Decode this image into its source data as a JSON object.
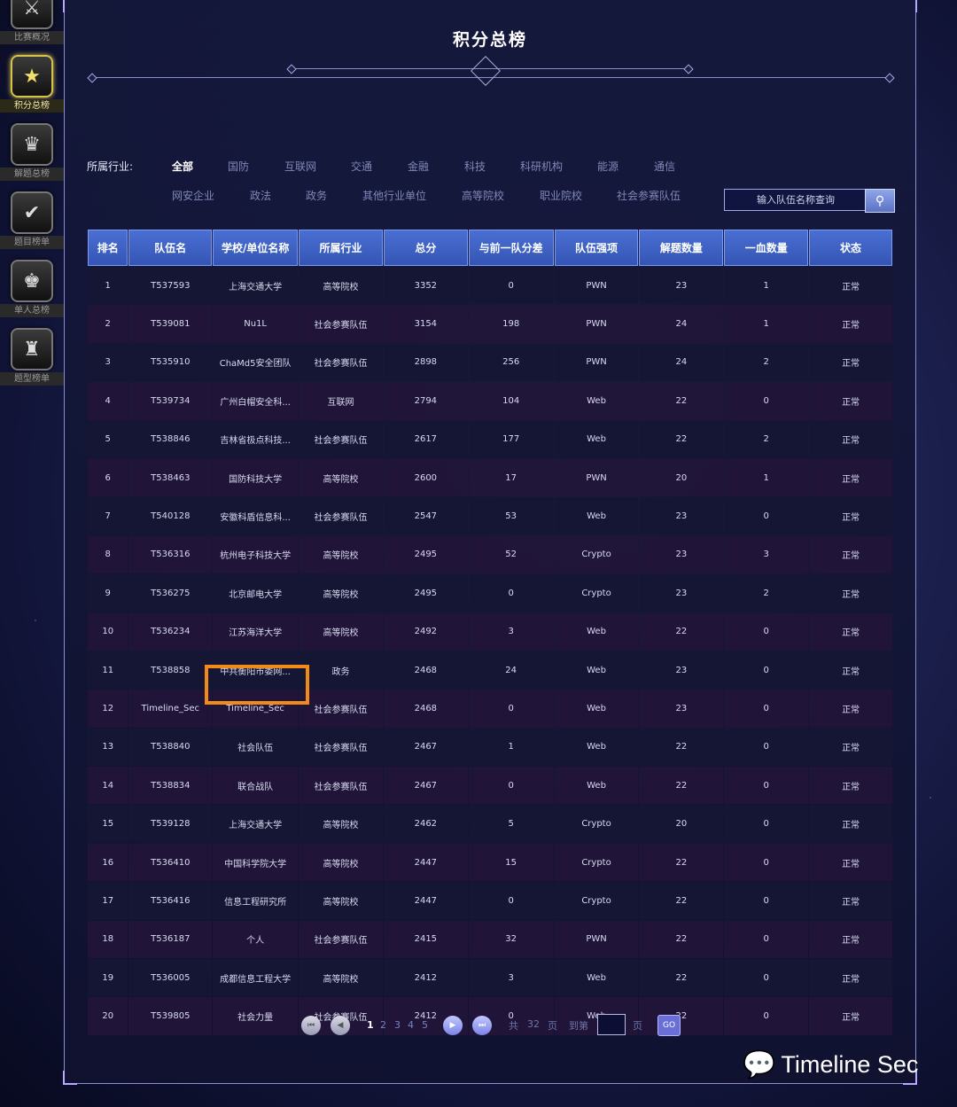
{
  "sidebar": [
    {
      "label": "比赛概况",
      "icon": "crossed-swords-icon",
      "glyph": "⚔",
      "active": false
    },
    {
      "label": "积分总榜",
      "icon": "star-badge-icon",
      "glyph": "★",
      "active": true
    },
    {
      "label": "解题总榜",
      "icon": "trophy-icon",
      "glyph": "♛",
      "active": false
    },
    {
      "label": "题目榜单",
      "icon": "check-badge-icon",
      "glyph": "✔",
      "active": false
    },
    {
      "label": "单人总榜",
      "icon": "crown-icon",
      "glyph": "♚",
      "active": false
    },
    {
      "label": "题型榜单",
      "icon": "cup-icon",
      "glyph": "♜",
      "active": false
    }
  ],
  "title": "积分总榜",
  "filters": {
    "label": "所属行业:",
    "row1": [
      "全部",
      "国防",
      "互联网",
      "交通",
      "金融",
      "科技",
      "科研机构",
      "能源",
      "通信"
    ],
    "row2": [
      "网安企业",
      "政法",
      "政务",
      "其他行业单位",
      "高等院校",
      "职业院校",
      "社会参赛队伍"
    ],
    "active": "全部"
  },
  "search": {
    "placeholder": "输入队伍名称查询"
  },
  "table": {
    "headers": [
      "排名",
      "队伍名",
      "学校/单位名称",
      "所属行业",
      "总分",
      "与前一队分差",
      "队伍强项",
      "解题数量",
      "一血数量",
      "状态"
    ],
    "rows": [
      [
        "1",
        "T537593",
        "上海交通大学",
        "高等院校",
        "3352",
        "0",
        "PWN",
        "23",
        "1",
        "正常"
      ],
      [
        "2",
        "T539081",
        "Nu1L",
        "社会参赛队伍",
        "3154",
        "198",
        "PWN",
        "24",
        "1",
        "正常"
      ],
      [
        "3",
        "T535910",
        "ChaMd5安全团队",
        "社会参赛队伍",
        "2898",
        "256",
        "PWN",
        "24",
        "2",
        "正常"
      ],
      [
        "4",
        "T539734",
        "广州白帽安全科...",
        "互联网",
        "2794",
        "104",
        "Web",
        "22",
        "0",
        "正常"
      ],
      [
        "5",
        "T538846",
        "吉林省极点科技...",
        "社会参赛队伍",
        "2617",
        "177",
        "Web",
        "22",
        "2",
        "正常"
      ],
      [
        "6",
        "T538463",
        "国防科技大学",
        "高等院校",
        "2600",
        "17",
        "PWN",
        "20",
        "1",
        "正常"
      ],
      [
        "7",
        "T540128",
        "安徽科盾信息科...",
        "社会参赛队伍",
        "2547",
        "53",
        "Web",
        "23",
        "0",
        "正常"
      ],
      [
        "8",
        "T536316",
        "杭州电子科技大学",
        "高等院校",
        "2495",
        "52",
        "Crypto",
        "23",
        "3",
        "正常"
      ],
      [
        "9",
        "T536275",
        "北京邮电大学",
        "高等院校",
        "2495",
        "0",
        "Crypto",
        "23",
        "2",
        "正常"
      ],
      [
        "10",
        "T536234",
        "江苏海洋大学",
        "高等院校",
        "2492",
        "3",
        "Web",
        "22",
        "0",
        "正常"
      ],
      [
        "11",
        "T538858",
        "中共衡阳市委网...",
        "政务",
        "2468",
        "24",
        "Web",
        "23",
        "0",
        "正常"
      ],
      [
        "12",
        "Timeline_Sec",
        "Timeline_Sec",
        "社会参赛队伍",
        "2468",
        "0",
        "Web",
        "23",
        "0",
        "正常"
      ],
      [
        "13",
        "T538840",
        "社会队伍",
        "社会参赛队伍",
        "2467",
        "1",
        "Web",
        "22",
        "0",
        "正常"
      ],
      [
        "14",
        "T538834",
        "联合战队",
        "社会参赛队伍",
        "2467",
        "0",
        "Web",
        "22",
        "0",
        "正常"
      ],
      [
        "15",
        "T539128",
        "上海交通大学",
        "高等院校",
        "2462",
        "5",
        "Crypto",
        "20",
        "0",
        "正常"
      ],
      [
        "16",
        "T536410",
        "中国科学院大学",
        "高等院校",
        "2447",
        "15",
        "Crypto",
        "22",
        "0",
        "正常"
      ],
      [
        "17",
        "T536416",
        "信息工程研究所",
        "高等院校",
        "2447",
        "0",
        "Crypto",
        "22",
        "0",
        "正常"
      ],
      [
        "18",
        "T536187",
        "个人",
        "社会参赛队伍",
        "2415",
        "32",
        "PWN",
        "22",
        "0",
        "正常"
      ],
      [
        "19",
        "T536005",
        "成都信息工程大学",
        "高等院校",
        "2412",
        "3",
        "Web",
        "22",
        "0",
        "正常"
      ],
      [
        "20",
        "T539805",
        "社会力量",
        "社会参赛队伍",
        "2412",
        "0",
        "Web",
        "22",
        "0",
        "正常"
      ]
    ]
  },
  "pagination": {
    "pages": [
      "1",
      "2",
      "3",
      "4",
      "5"
    ],
    "current": "1",
    "total_prefix": "共",
    "total_pages": "32",
    "total_suffix": "页",
    "goto_label": "到第",
    "goto_suffix": "页",
    "go_label": "GO"
  },
  "watermark": {
    "text": "Timeline Sec",
    "icon": "wechat-icon"
  },
  "colors": {
    "header": "#3f63c8",
    "highlight": "#f28a1a",
    "accent": "#6a6fd8"
  }
}
